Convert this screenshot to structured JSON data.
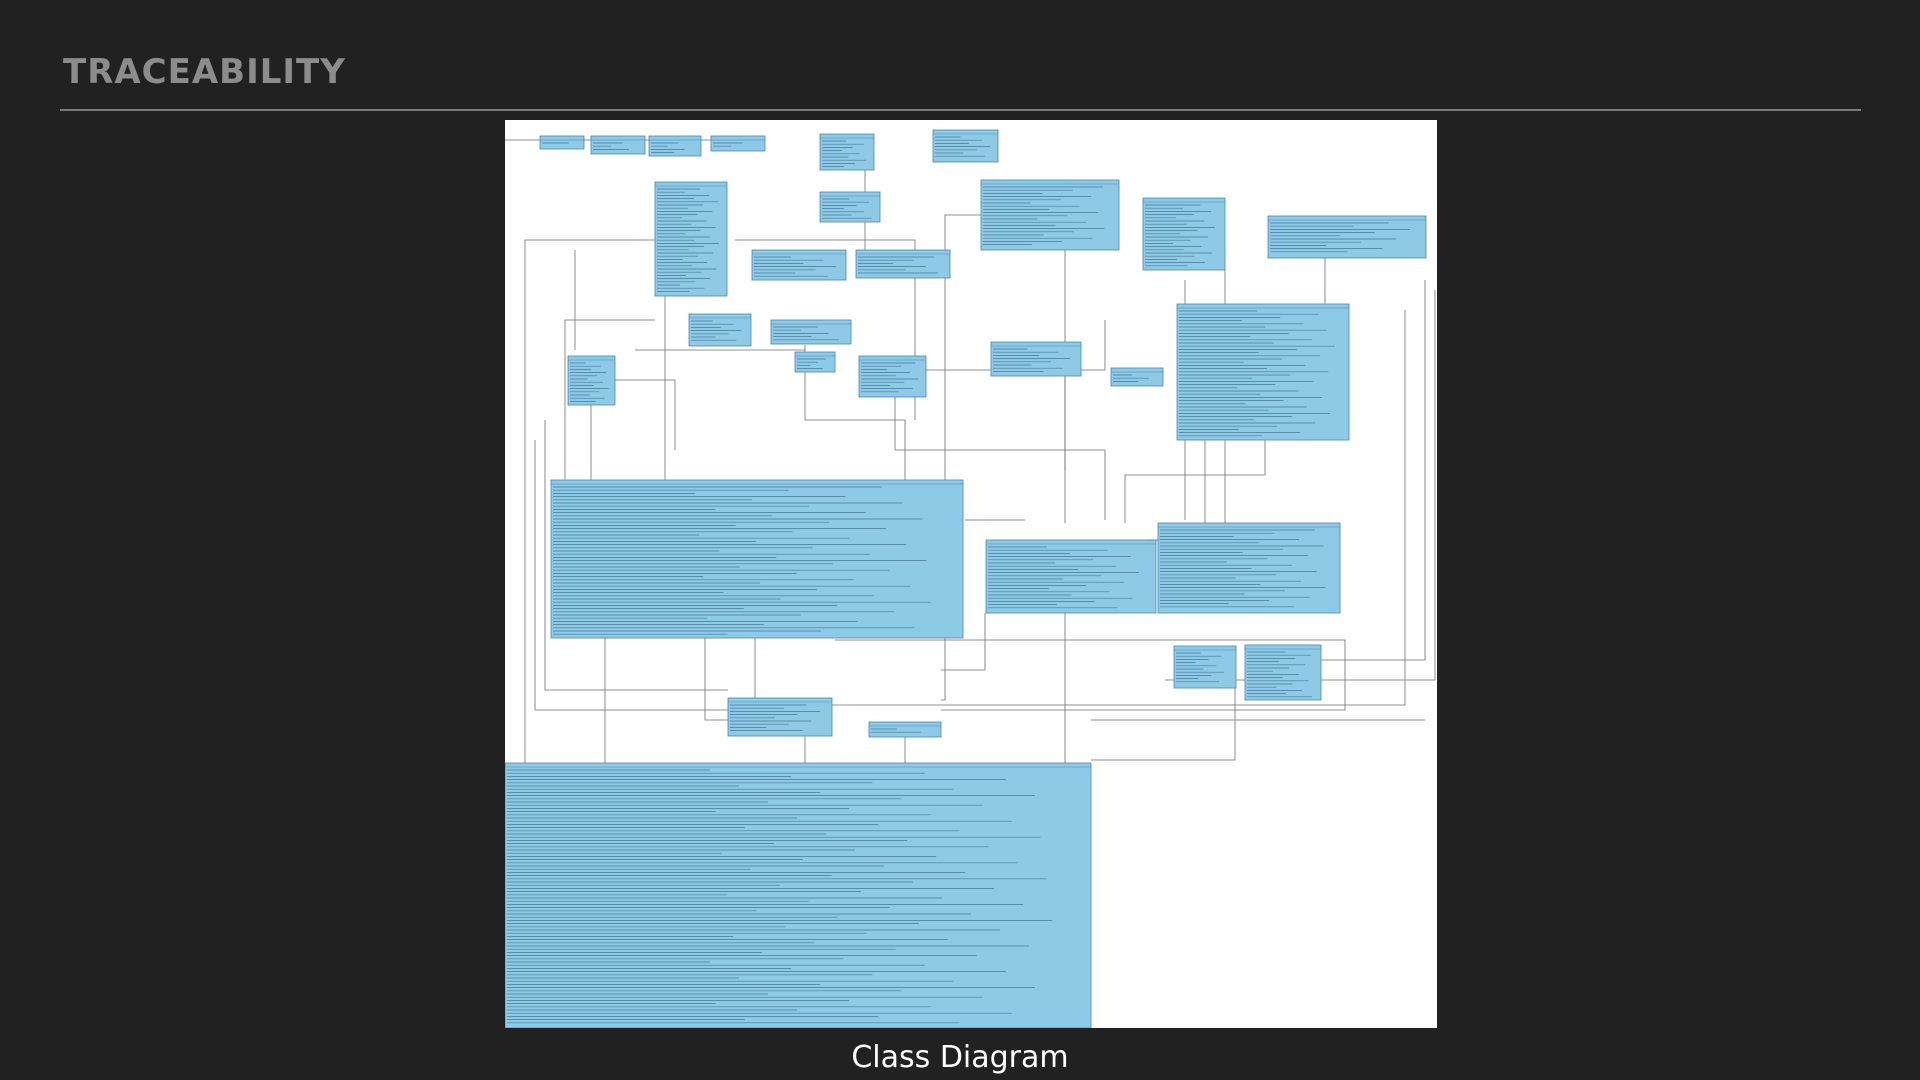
{
  "slide": {
    "title": "TRACEABILITY",
    "caption": "Class Diagram"
  },
  "colors": {
    "background": "#212121",
    "title": "#8c8c8c",
    "rule": "#7a7a7a",
    "class_fill": "#8ecae6",
    "class_border": "#4a86b0",
    "connector": "#6e6e6e"
  },
  "diagram": {
    "note": "",
    "class_count": 30
  }
}
